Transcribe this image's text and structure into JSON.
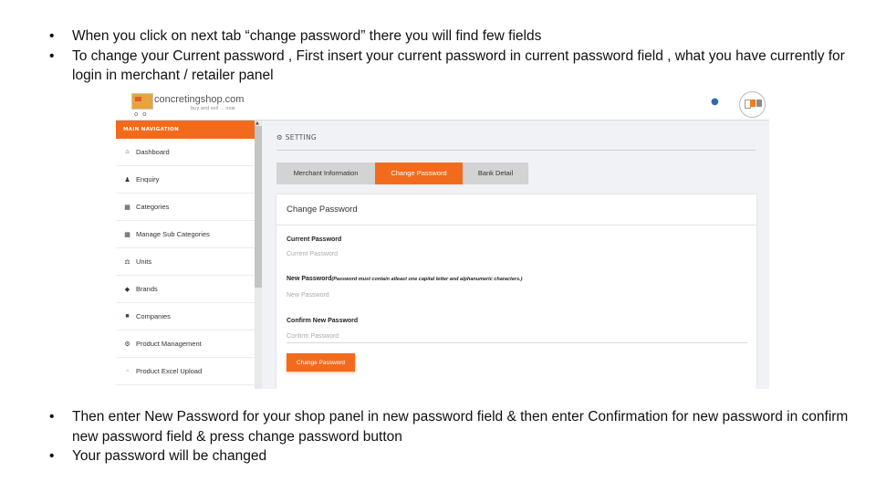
{
  "instructions_top": [
    "When you click on next tab “change password” there you will find few fields",
    "To change your Current password , First insert your current password in current password field , what you have currently for login in merchant / retailer panel"
  ],
  "instructions_bottom": [
    "Then enter New Password for your shop panel in new password field & then enter Confirmation for new password in confirm new password field & press change password button",
    "Your password will be changed"
  ],
  "bullet_glyph": "•",
  "app": {
    "logo_text": "concretingshop.com",
    "logo_tagline": "buy and sell ... now",
    "icons": {
      "notifications": "bell-icon",
      "avatar": "user-avatar"
    },
    "sidebar": {
      "header": "MAIN NAVIGATION",
      "items": [
        {
          "label": "Dashboard",
          "icon": "home-icon",
          "glyph": "⌂"
        },
        {
          "label": "Enquiry",
          "icon": "user-icon",
          "glyph": "♟"
        },
        {
          "label": "Categories",
          "icon": "grid-icon",
          "glyph": "▦"
        },
        {
          "label": "Manage Sub Categories",
          "icon": "grid-icon",
          "glyph": "▦"
        },
        {
          "label": "Units",
          "icon": "balance-scale-icon",
          "glyph": "⚖"
        },
        {
          "label": "Brands",
          "icon": "tags-icon",
          "glyph": "◆"
        },
        {
          "label": "Companies",
          "icon": "building-icon",
          "glyph": "■"
        },
        {
          "label": "Product Management",
          "icon": "gears-icon",
          "glyph": "⚙"
        },
        {
          "label": "Product Excel Upload",
          "icon": "file-excel-icon",
          "glyph": "▫"
        }
      ]
    },
    "setting_title": "SETTING",
    "tabs": [
      {
        "label": "Merchant Information",
        "active": false
      },
      {
        "label": "Change Password",
        "active": true
      },
      {
        "label": "Bank Detail",
        "active": false
      }
    ],
    "form": {
      "title": "Change Password",
      "current_label": "Current Password",
      "current_placeholder": "Current Password",
      "new_label": "New Password",
      "new_hint": "(Password must contain atleast one capital letter and alphanumeric characters.)",
      "new_placeholder": "New Password",
      "confirm_label": "Confirm New Password",
      "confirm_placeholder": "Confirm Password",
      "submit_label": "Change Password"
    },
    "colors": {
      "accent": "#f26b1d",
      "tab_inactive": "#d3d3d3",
      "background": "#f1f2f5"
    }
  }
}
